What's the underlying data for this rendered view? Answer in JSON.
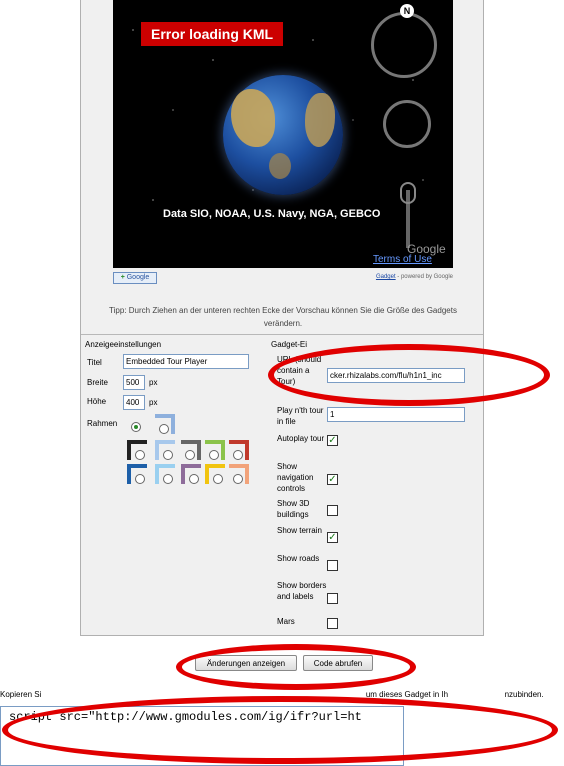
{
  "preview": {
    "error_text": "Error loading KML",
    "data_credit": "Data SIO, NOAA, U.S. Navy, NGA, GEBCO",
    "north_label": "N",
    "google_logo": "Google",
    "terms_link": "Terms of Use",
    "add_badge_plus": "+",
    "add_badge_text": "Google",
    "gadget_link": "Gadget",
    "powered_by": " - powered by Google",
    "tip": "Tipp: Durch Ziehen an der unteren rechten Ecke der Vorschau können Sie die Größe des Gadgets verändern."
  },
  "display_settings": {
    "heading": "Anzeigeeinstellungen",
    "title_label": "Titel",
    "title_value": "Embedded Tour Player",
    "width_label": "Breite",
    "width_value": "500",
    "width_unit": "px",
    "height_label": "Höhe",
    "height_value": "400",
    "height_unit": "px",
    "frame_label": "Rahmen"
  },
  "gadget_settings": {
    "heading": "Gadget-Ei",
    "kml_label": "URL (should contain a Tour)",
    "kml_value": "cker.rhizalabs.com/flu/h1n1_inc",
    "play_label": "Play n'th tour in file",
    "play_value": "1",
    "options": [
      {
        "label": "Autoplay tour",
        "checked": true
      },
      {
        "label": "Show navigation controls",
        "checked": true
      },
      {
        "label": "Show 3D buildings",
        "checked": false
      },
      {
        "label": "Show terrain",
        "checked": true
      },
      {
        "label": "Show roads",
        "checked": false
      },
      {
        "label": "Show borders and labels",
        "checked": false
      },
      {
        "label": "Mars",
        "checked": false
      }
    ]
  },
  "buttons": {
    "preview_changes": "Änderungen anzeigen",
    "get_code": "Code abrufen"
  },
  "copy_instruction": {
    "start": "Kopieren Si",
    "end": "um dieses Gadget in Ih",
    "tail": "nzubinden."
  },
  "code_text": "script src=\"http://www.gmodules.com/ig/ifr?url=ht",
  "colors": {
    "annotation": "#e00000",
    "error_bg": "#cc0000",
    "frame_bg": "#f0f0f0"
  }
}
